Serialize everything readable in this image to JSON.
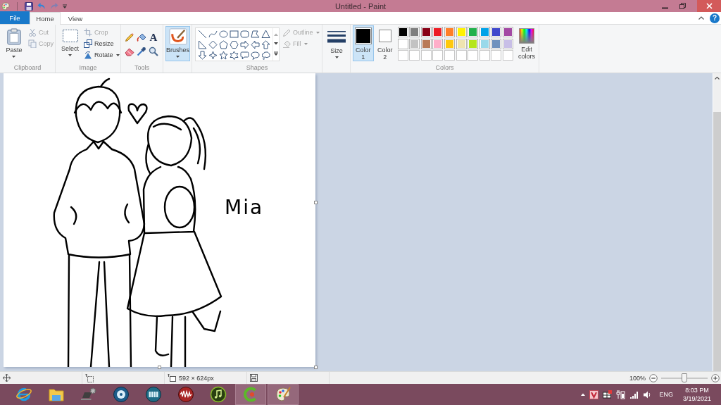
{
  "window": {
    "title": "Untitled - Paint"
  },
  "quick_access": {
    "undo": {
      "disabled": false
    },
    "redo": {
      "disabled": true
    }
  },
  "tabs": [
    {
      "label": "File",
      "kind": "file",
      "selected": false
    },
    {
      "label": "Home",
      "kind": "tab",
      "selected": true
    },
    {
      "label": "View",
      "kind": "tab",
      "selected": false
    }
  ],
  "help": "?",
  "ribbon": {
    "clipboard": {
      "label": "Clipboard",
      "paste": "Paste",
      "items": [
        {
          "kind": "cut",
          "label": "Cut",
          "disabled": true,
          "dropdown": false
        },
        {
          "kind": "copy",
          "label": "Copy",
          "disabled": true,
          "dropdown": false
        }
      ]
    },
    "image": {
      "label": "Image",
      "select": "Select",
      "items": [
        {
          "kind": "crop",
          "label": "Crop",
          "disabled": true,
          "dropdown": false
        },
        {
          "kind": "resize",
          "label": "Resize",
          "disabled": false,
          "dropdown": false
        },
        {
          "kind": "rotate",
          "label": "Rotate",
          "disabled": false,
          "dropdown": true
        }
      ]
    },
    "tools": {
      "label": "Tools",
      "text_glyph": "A"
    },
    "brushes": {
      "label": "Brushes",
      "selected": true
    },
    "shapes": {
      "label": "Shapes",
      "options": [
        {
          "kind": "outline",
          "label": "Outline",
          "disabled": true,
          "dropdown": true
        },
        {
          "kind": "fill",
          "label": "Fill",
          "disabled": true,
          "dropdown": true
        }
      ]
    },
    "size": {
      "label": "Size"
    },
    "colors": {
      "label": "Colors",
      "slots": [
        {
          "label": "Color 1",
          "color": "#000000",
          "selected": true
        },
        {
          "label": "Color 2",
          "color": "#ffffff",
          "selected": false
        }
      ],
      "palette": [
        {
          "kind": "swatch",
          "color": "#000000"
        },
        {
          "kind": "swatch",
          "color": "#7f7f7f"
        },
        {
          "kind": "swatch",
          "color": "#880015"
        },
        {
          "kind": "swatch",
          "color": "#ed1c24"
        },
        {
          "kind": "swatch",
          "color": "#ff7f27"
        },
        {
          "kind": "swatch",
          "color": "#fff200"
        },
        {
          "kind": "swatch",
          "color": "#22b14c"
        },
        {
          "kind": "swatch",
          "color": "#00a2e8"
        },
        {
          "kind": "swatch",
          "color": "#3f48cc"
        },
        {
          "kind": "swatch",
          "color": "#a349a4"
        },
        {
          "kind": "swatch",
          "color": "#ffffff"
        },
        {
          "kind": "swatch",
          "color": "#c3c3c3"
        },
        {
          "kind": "swatch",
          "color": "#b97a57"
        },
        {
          "kind": "swatch",
          "color": "#ffaec9"
        },
        {
          "kind": "swatch",
          "color": "#ffc90e"
        },
        {
          "kind": "swatch",
          "color": "#efe4b0"
        },
        {
          "kind": "swatch",
          "color": "#b5e61d"
        },
        {
          "kind": "swatch",
          "color": "#99d9ea"
        },
        {
          "kind": "swatch",
          "color": "#7092be"
        },
        {
          "kind": "swatch",
          "color": "#c8bfe7"
        },
        {
          "kind": "empty"
        },
        {
          "kind": "empty"
        },
        {
          "kind": "empty"
        },
        {
          "kind": "empty"
        },
        {
          "kind": "empty"
        },
        {
          "kind": "empty"
        },
        {
          "kind": "empty"
        },
        {
          "kind": "empty"
        },
        {
          "kind": "empty"
        },
        {
          "kind": "empty"
        }
      ],
      "edit": "Edit colors"
    }
  },
  "canvas": {
    "signature": "Mia"
  },
  "status_bar": {
    "dimensions": "592 × 624px",
    "zoom": "100%",
    "zoom_slider": {
      "level": 0.5
    }
  },
  "taskbar": {
    "apps": [
      {
        "kind": "browser",
        "highlighted": false
      },
      {
        "kind": "folder",
        "highlighted": false
      },
      {
        "kind": "laptop",
        "highlighted": false
      },
      {
        "kind": "disc",
        "highlighted": false
      },
      {
        "kind": "film",
        "highlighted": false
      },
      {
        "kind": "audio",
        "highlighted": false
      },
      {
        "kind": "music",
        "highlighted": false
      },
      {
        "kind": "cleaner",
        "highlighted": true
      },
      {
        "kind": "paint",
        "highlighted": true
      }
    ],
    "tray": {
      "language": "ENG",
      "time": "8:03 PM",
      "date": "3/19/2021"
    }
  }
}
